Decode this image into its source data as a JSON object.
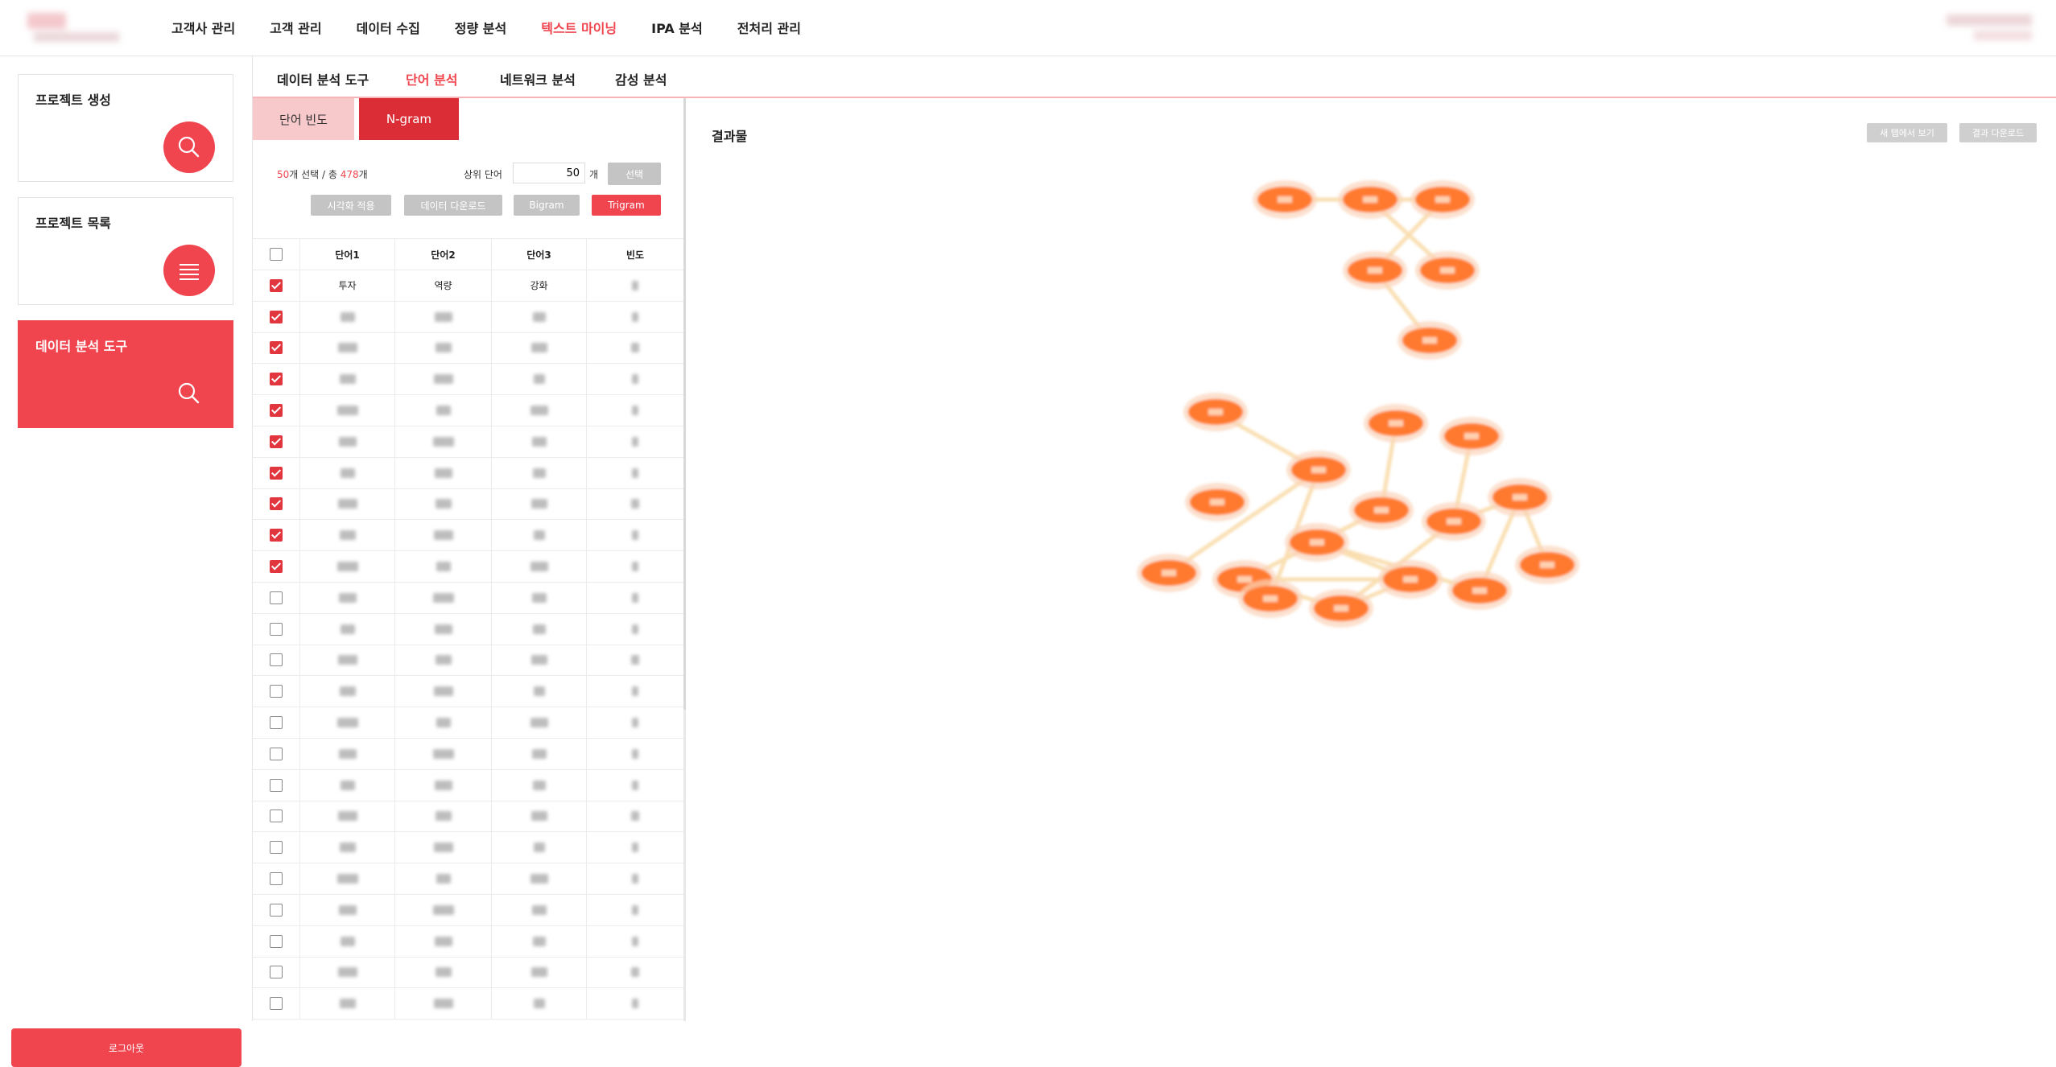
{
  "topnav": {
    "menu": [
      "고객사 관리",
      "고객 관리",
      "데이터 수집",
      "정량 분석",
      "텍스트 마이닝",
      "IPA 분석",
      "전처리 관리"
    ],
    "active_index": 4
  },
  "sidebar": {
    "cards": [
      {
        "label": "프로젝트 생성",
        "icon": "search-icon"
      },
      {
        "label": "프로젝트 목록",
        "icon": "list-icon"
      },
      {
        "label": "데이터 분석 도구",
        "icon": "search-icon"
      }
    ],
    "logout_label": "로그아웃"
  },
  "subtabs": {
    "items": [
      "데이터 분석 도구",
      "단어 분석",
      "네트워크 분석",
      "감성 분석"
    ],
    "active_index": 1
  },
  "left_panel": {
    "mode_tabs": [
      "단어 빈도",
      "N-gram"
    ],
    "active_mode": "N-gram",
    "selected_count": "50",
    "selected_suffix": "개 선택 / 총 ",
    "total_count": "478",
    "total_suffix": "개",
    "top_words_label": "상위 단어",
    "top_words_value": "50",
    "unit_label": "개",
    "select_button": "선택",
    "actions": [
      "시각화 적용",
      "데이터 다운로드",
      "Bigram",
      "Trigram"
    ],
    "active_action": "Trigram"
  },
  "table": {
    "headers": [
      "단어1",
      "단어2",
      "단어3",
      "빈도"
    ],
    "first_row": [
      "투자",
      "역량",
      "강화"
    ],
    "checked_rows": 10,
    "total_rows": 24
  },
  "result": {
    "title": "결과물",
    "open_new_tab": "새 탭에서 보기",
    "download": "결과 다운로드"
  },
  "colors": {
    "accent": "#f0454f",
    "active_tab_dark": "#db2d36",
    "node": "#ff7a2e"
  }
}
